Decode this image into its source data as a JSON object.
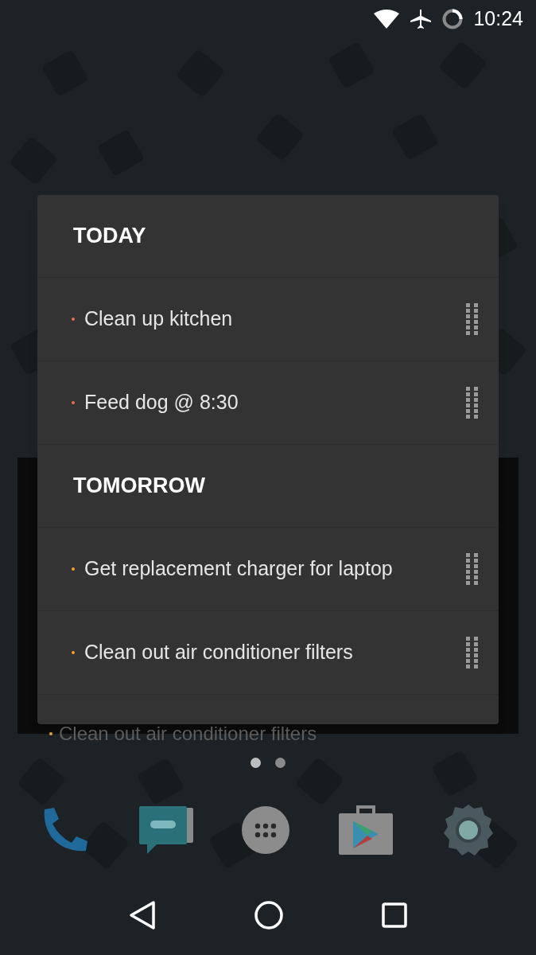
{
  "status_bar": {
    "time": "10:24"
  },
  "widget": {
    "sections": [
      {
        "title": "TODAY",
        "items": [
          {
            "text": "Clean up kitchen",
            "color": "#e8704a"
          },
          {
            "text": "Feed dog @ 8:30",
            "color": "#e8704a"
          }
        ]
      },
      {
        "title": "TOMORROW",
        "items": [
          {
            "text": "Get replacement charger for laptop",
            "color": "#f0a030"
          },
          {
            "text": "Clean out air conditioner filters",
            "color": "#f0a030"
          }
        ]
      }
    ]
  },
  "background_widget": {
    "item": {
      "text": "Clean out air conditioner filters",
      "color": "#f0a030"
    }
  },
  "page_indicator": [
    {
      "selected": true
    },
    {
      "selected": false
    }
  ],
  "dock": [
    {
      "kind": "phone"
    },
    {
      "kind": "messages"
    },
    {
      "kind": "apps"
    },
    {
      "kind": "store"
    },
    {
      "kind": "settings"
    }
  ]
}
